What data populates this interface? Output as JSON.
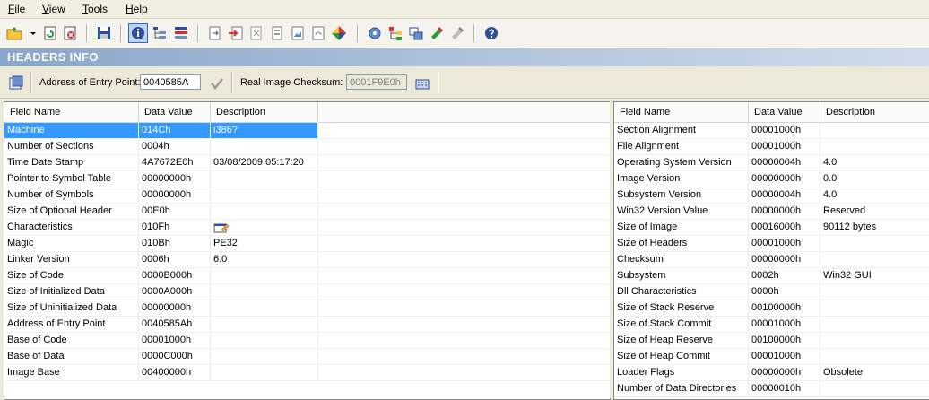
{
  "menu": {
    "file": {
      "u": "F",
      "rest": "ile"
    },
    "view": {
      "u": "V",
      "rest": "iew"
    },
    "tools": {
      "u": "T",
      "rest": "ools"
    },
    "help": {
      "u": "H",
      "rest": "elp"
    }
  },
  "section_title": "HEADERS INFO",
  "entry_point": {
    "label": "Address of Entry Point:",
    "value": "0040585A"
  },
  "checksum": {
    "label": "Real Image Checksum:",
    "value": "0001F9E0h"
  },
  "colors": {
    "selected": "#3399ff",
    "banner": "#8aa6c8"
  },
  "left_table": {
    "columns": [
      "Field Name",
      "Data Value",
      "Description"
    ],
    "rows": [
      {
        "name": "Machine",
        "value": "014Ch",
        "desc": "i386?"
      },
      {
        "name": "Number of Sections",
        "value": "0004h",
        "desc": ""
      },
      {
        "name": "Time Date Stamp",
        "value": "4A7672E0h",
        "desc": "03/08/2009  05:17:20"
      },
      {
        "name": "Pointer to Symbol Table",
        "value": "00000000h",
        "desc": ""
      },
      {
        "name": "Number of Symbols",
        "value": "00000000h",
        "desc": ""
      },
      {
        "name": "Size of Optional Header",
        "value": "00E0h",
        "desc": ""
      },
      {
        "name": "Characteristics",
        "value": "010Fh",
        "desc": ""
      },
      {
        "name": "Magic",
        "value": "010Bh",
        "desc": "PE32"
      },
      {
        "name": "Linker Version",
        "value": "0006h",
        "desc": "6.0"
      },
      {
        "name": "Size of Code",
        "value": "0000B000h",
        "desc": ""
      },
      {
        "name": "Size of Initialized Data",
        "value": "0000A000h",
        "desc": ""
      },
      {
        "name": "Size of Uninitialized Data",
        "value": "00000000h",
        "desc": ""
      },
      {
        "name": "Address of Entry Point",
        "value": "0040585Ah",
        "desc": ""
      },
      {
        "name": "Base of Code",
        "value": "00001000h",
        "desc": ""
      },
      {
        "name": "Base of Data",
        "value": "0000C000h",
        "desc": ""
      },
      {
        "name": "Image Base",
        "value": "00400000h",
        "desc": ""
      }
    ]
  },
  "right_table": {
    "columns": [
      "Field Name",
      "Data Value",
      "Description"
    ],
    "rows": [
      {
        "name": "Section Alignment",
        "value": "00001000h",
        "desc": ""
      },
      {
        "name": "File Alignment",
        "value": "00001000h",
        "desc": ""
      },
      {
        "name": "Operating System Version",
        "value": "00000004h",
        "desc": "4.0"
      },
      {
        "name": "Image Version",
        "value": "00000000h",
        "desc": "0.0"
      },
      {
        "name": "Subsystem Version",
        "value": "00000004h",
        "desc": "4.0"
      },
      {
        "name": "Win32 Version Value",
        "value": "00000000h",
        "desc": "Reserved"
      },
      {
        "name": "Size of Image",
        "value": "00016000h",
        "desc": "90112 bytes"
      },
      {
        "name": "Size of Headers",
        "value": "00001000h",
        "desc": ""
      },
      {
        "name": "Checksum",
        "value": "00000000h",
        "desc": ""
      },
      {
        "name": "Subsystem",
        "value": "0002h",
        "desc": "Win32 GUI"
      },
      {
        "name": "Dll Characteristics",
        "value": "0000h",
        "desc": ""
      },
      {
        "name": "Size of Stack Reserve",
        "value": "00100000h",
        "desc": ""
      },
      {
        "name": "Size of Stack Commit",
        "value": "00001000h",
        "desc": ""
      },
      {
        "name": "Size of Heap Reserve",
        "value": "00100000h",
        "desc": ""
      },
      {
        "name": "Size of Heap Commit",
        "value": "00001000h",
        "desc": ""
      },
      {
        "name": "Loader Flags",
        "value": "00000000h",
        "desc": "Obsolete"
      },
      {
        "name": "Number of Data Directories",
        "value": "00000010h",
        "desc": ""
      }
    ]
  }
}
